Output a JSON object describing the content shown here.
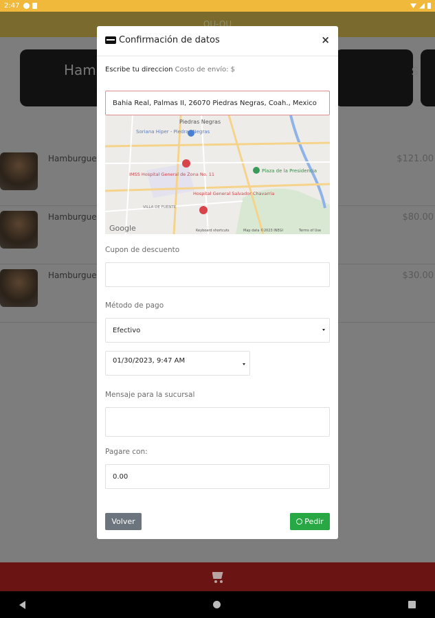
{
  "status_bar": {
    "time": "2:47"
  },
  "app_bar": {
    "title": "QU-QU"
  },
  "categories": [
    {
      "label": "Ham"
    },
    {
      "label": "s"
    }
  ],
  "products": [
    {
      "name": "Hamburgue",
      "price": "$121.00"
    },
    {
      "name": "Hamburgue",
      "price": "$80.00"
    },
    {
      "name": "Hamburgue",
      "price": "$30.00"
    }
  ],
  "modal": {
    "title": "Confirmación de datos",
    "close": "×",
    "address_label": "Escribe tu direccion",
    "shipping_label": "Costo de envío: $",
    "address_value": "Bahia Real, Palmas II, 26070 Piedras Negras, Coah., Mexico",
    "map": {
      "labels": [
        "Piedras Negras",
        "Soriana Hiper - Piedras Negras",
        "IMSS Hospital General de Zona No. 11",
        "Hospital General Salvador Chavarria",
        "Plaza de la Presidencia",
        "VILLA DE FUENTE",
        "Google",
        "Keyboard shortcuts",
        "Map data ©2023 INEGI",
        "Terms of Use"
      ]
    },
    "coupon_label": "Cupon de descuento",
    "coupon_value": "",
    "payment_label": "Método de pago",
    "payment_value": "Efectivo",
    "datetime_value": "01/30/2023, 9:47 AM",
    "message_label": "Mensaje para la sucursal",
    "message_value": "",
    "pay_with_label": "Pagare con:",
    "pay_with_value": "0.00",
    "back_button": "Volver",
    "order_button": "Pedir"
  },
  "colors": {
    "accent_bar": "#f0b93b",
    "cart_bar": "#6b1414",
    "order_button": "#28a745",
    "back_button": "#6c757d"
  }
}
